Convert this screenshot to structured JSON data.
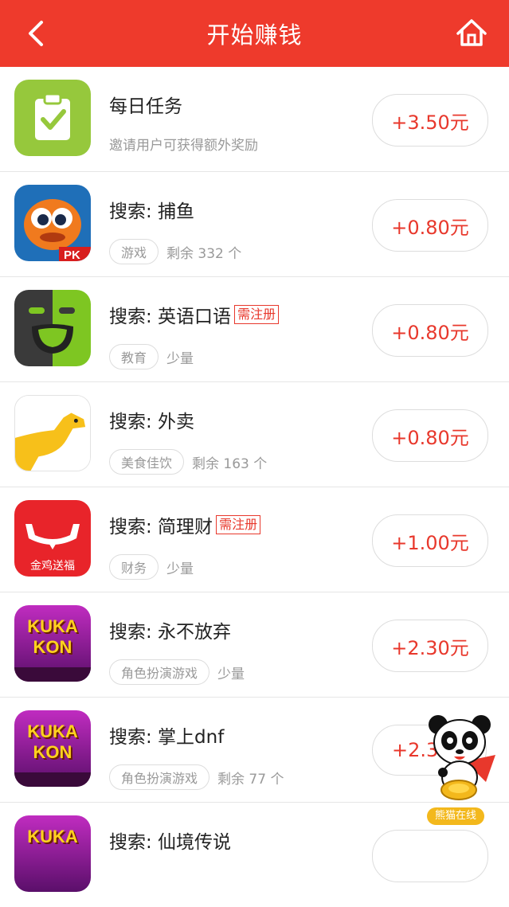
{
  "header": {
    "title": "开始赚钱",
    "back_icon": "chevron-left-icon",
    "home_icon": "home-icon",
    "bg_color": "#ee3a2c"
  },
  "tasks": [
    {
      "name": "每日任务",
      "desc": "邀请用户可获得额外奖励",
      "reward": "+3.50元",
      "icon": "clipboard-check-icon"
    },
    {
      "name": "搜索: 捕鱼",
      "category": "游戏",
      "remain": "剩余 332 个",
      "reward": "+0.80元",
      "icon": "fish-game-icon"
    },
    {
      "name": "搜索: 英语口语",
      "badge": "需注册",
      "category": "教育",
      "remain": "少量",
      "reward": "+0.80元",
      "icon": "speech-face-icon"
    },
    {
      "name": "搜索: 外卖",
      "category": "美食佳饮",
      "remain": "剩余 163 个",
      "reward": "+0.80元",
      "icon": "kangaroo-icon"
    },
    {
      "name": "搜索: 简理财",
      "badge": "需注册",
      "category": "财务",
      "remain": "少量",
      "reward": "+1.00元",
      "icon": "finance-app-icon",
      "icon_text": "金鸡送福"
    },
    {
      "name": "搜索: 永不放弃",
      "category": "角色扮演游戏",
      "remain": "少量",
      "reward": "+2.30元",
      "icon": "kukakon-game-icon",
      "icon_text": "KUKA KON"
    },
    {
      "name": "搜索: 掌上dnf",
      "category": "角色扮演游戏",
      "remain": "剩余 77 个",
      "reward": "+2.3",
      "icon": "kukakon-game-icon",
      "icon_text": "KUKA KON"
    },
    {
      "name": "搜索: 仙境传说",
      "icon": "kukakon-game-icon",
      "icon_text": "KUKA"
    }
  ],
  "float_widget": {
    "label": "熊猫在线",
    "icon": "panda-mascot-icon"
  },
  "colors": {
    "accent": "#e8382c",
    "muted": "#999999"
  }
}
